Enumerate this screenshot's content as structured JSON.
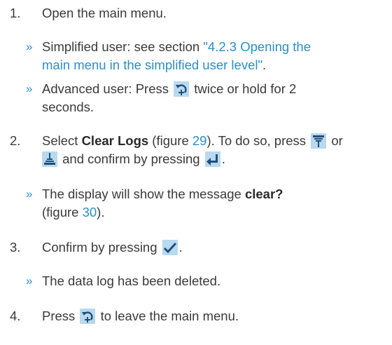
{
  "steps": {
    "s1_num": "1.",
    "s1_text": "Open the main menu.",
    "s1_b1_l1_pre": "Simplified user: see section ",
    "s1_b1_l1_link": "\"4.2.3 Opening the",
    "s1_b1_l2_link": "main menu in the simplified user level\"",
    "s1_b1_l2_post": ".",
    "s1_b2_l1_pre": "Advanced user: Press",
    "s1_b2_l1_post": "twice or hold for 2",
    "s1_b2_l2": "seconds.",
    "s2_num": "2.",
    "s2_l1_pre": "Select ",
    "s2_l1_bold": "Clear Logs",
    "s2_l1_mid": " (figure ",
    "s2_l1_fig": "29",
    "s2_l1_post": "). To do so, press",
    "s2_l1_or": "or",
    "s2_l2_mid": "and confirm by pressing",
    "s2_l2_post": ".",
    "s2_b1_l1_pre": "The display will show the message ",
    "s2_b1_l1_bold": "clear?",
    "s2_b1_l2_pre": "(figure ",
    "s2_b1_l2_fig": "30",
    "s2_b1_l2_post": ").",
    "s3_num": "3.",
    "s3_pre": "Confirm by pressing",
    "s3_post": ".",
    "s3_b1": "The data log has been deleted.",
    "s4_num": "4.",
    "s4_pre": "Press",
    "s4_post": "to leave the main menu.",
    "bullet": "»"
  },
  "icons": {
    "menu": "menu-key-icon",
    "down": "down-key-icon",
    "up": "up-key-icon",
    "enter": "enter-key-icon",
    "confirm": "checkmark-key-icon"
  },
  "colors": {
    "link": "#2a8ec9",
    "icon_bg": "#b8d9ee",
    "icon_fg": "#1f4f7a"
  }
}
